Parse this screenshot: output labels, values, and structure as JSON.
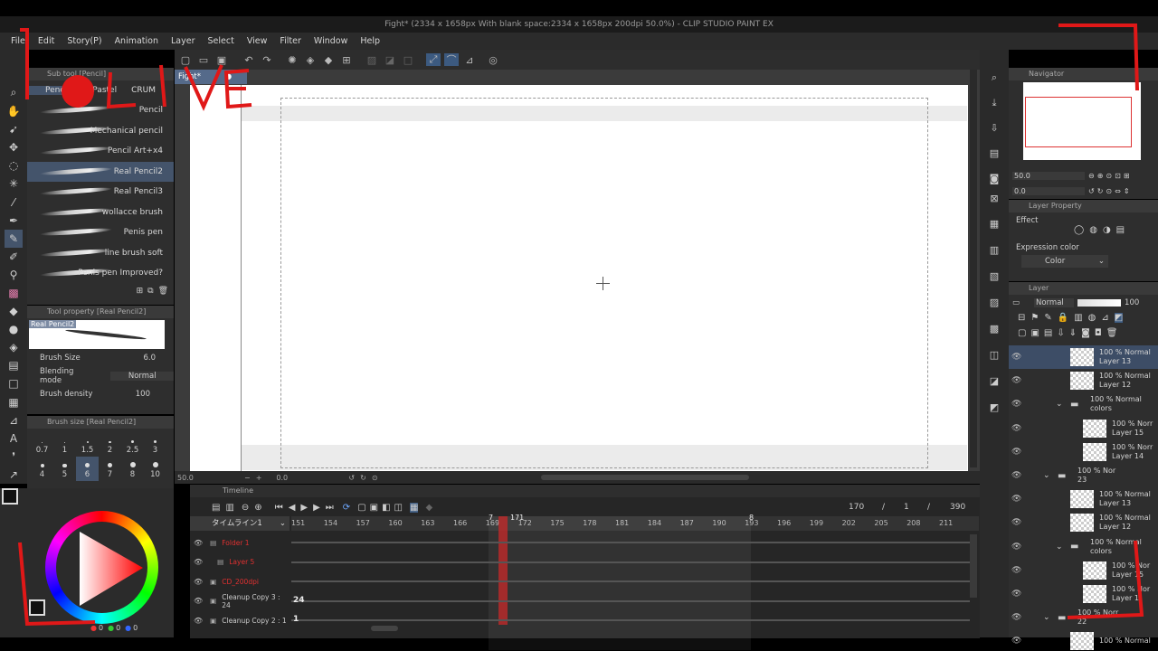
{
  "window": {
    "title": "Fight* (2334 x 1658px With blank space:2334 x 1658px 200dpi 50.0%) - CLIP STUDIO PAINT EX"
  },
  "menu": [
    "File",
    "Edit",
    "Story(P)",
    "Animation",
    "Layer",
    "Select",
    "View",
    "Filter",
    "Window",
    "Help"
  ],
  "canvas_tab": "Fight*",
  "subtool": {
    "header": "Sub tool [Pencil]",
    "tabs": [
      "Pencil",
      "Pastel",
      "CRUM"
    ],
    "brushes": [
      "Pencil",
      "Mechanical pencil",
      "Pencil Art+x4",
      "Real Pencil2",
      "Real Pencil3",
      "wollacce brush",
      "Penis pen",
      "line brush soft",
      "Penis pen Improved?"
    ],
    "selected": 3
  },
  "tool_property": {
    "header": "Tool property [Real Pencil2]",
    "preview": "Real Pencil2",
    "brush_size_label": "Brush Size",
    "brush_size": "6.0",
    "blending_label": "Blending mode",
    "blending_value": "Normal",
    "density_label": "Brush density",
    "density_value": "100"
  },
  "brush_size_panel": {
    "header": "Brush size [Real Pencil2]",
    "sizes": [
      "0.7",
      "1",
      "1.5",
      "2",
      "2.5",
      "3",
      "4",
      "5",
      "6",
      "7",
      "8",
      "10"
    ],
    "selected": 8
  },
  "color_values": [
    "0",
    "0",
    "0"
  ],
  "canvas_bottom": {
    "zoom": "50.0",
    "rotation": "0.0"
  },
  "timeline": {
    "header": "Timeline",
    "name": "タイムライン1",
    "current": "170",
    "page": "1",
    "total": "390",
    "frames": [
      "151",
      "154",
      "157",
      "160",
      "163",
      "166",
      "169",
      "172",
      "175",
      "178",
      "181",
      "184",
      "187",
      "190",
      "193",
      "196",
      "199",
      "202",
      "205",
      "208",
      "211"
    ],
    "playhead": "171",
    "marker_7": "7",
    "marker_8": "8",
    "tracks": [
      {
        "name": "Folder 1",
        "frame": ""
      },
      {
        "name": "Layer 5",
        "frame": ""
      },
      {
        "name": "CD_200dpi",
        "frame": ""
      },
      {
        "name": "Cleanup Copy 3 : 24",
        "frame": "24"
      },
      {
        "name": "Cleanup Copy 2 : 1",
        "frame": "1"
      }
    ]
  },
  "navigator": {
    "header": "Navigator",
    "zoom": "50.0",
    "rotation": "0.0"
  },
  "layer_property": {
    "header": "Layer Property",
    "effect_label": "Effect",
    "expression_label": "Expression color",
    "expression_value": "Color"
  },
  "layer_panel": {
    "header": "Layer",
    "blend": "Normal",
    "opacity": "100",
    "layers": [
      {
        "line1": "100 % Normal",
        "line2": "Layer 13",
        "indent": 0,
        "folder": false,
        "selected": true
      },
      {
        "line1": "100 % Normal",
        "line2": "Layer 12",
        "indent": 0,
        "folder": false
      },
      {
        "line1": "100 % Normal",
        "line2": "colors",
        "indent": 0,
        "folder": true
      },
      {
        "line1": "100 % Norr",
        "line2": "Layer 15",
        "indent": 1,
        "folder": false
      },
      {
        "line1": "100 % Norr",
        "line2": "Layer 14",
        "indent": 1,
        "folder": false
      },
      {
        "line1": "100 % Nor",
        "line2": "23",
        "indent": -1,
        "folder": true
      },
      {
        "line1": "100 % Normal",
        "line2": "Layer 13",
        "indent": 0,
        "folder": false
      },
      {
        "line1": "100 % Normal",
        "line2": "Layer 12",
        "indent": 0,
        "folder": false
      },
      {
        "line1": "100 % Normal",
        "line2": "colors",
        "indent": 0,
        "folder": true
      },
      {
        "line1": "100 % Nor",
        "line2": "Layer 15",
        "indent": 1,
        "folder": false
      },
      {
        "line1": "100 % Nor",
        "line2": "Layer 1",
        "indent": 1,
        "folder": false
      },
      {
        "line1": "100 % Norr",
        "line2": "22",
        "indent": -1,
        "folder": true
      },
      {
        "line1": "100 % Normal",
        "line2": "",
        "indent": 0,
        "folder": false
      }
    ]
  },
  "overlay": {
    "text": "LIVE",
    "color": "#e01818"
  }
}
